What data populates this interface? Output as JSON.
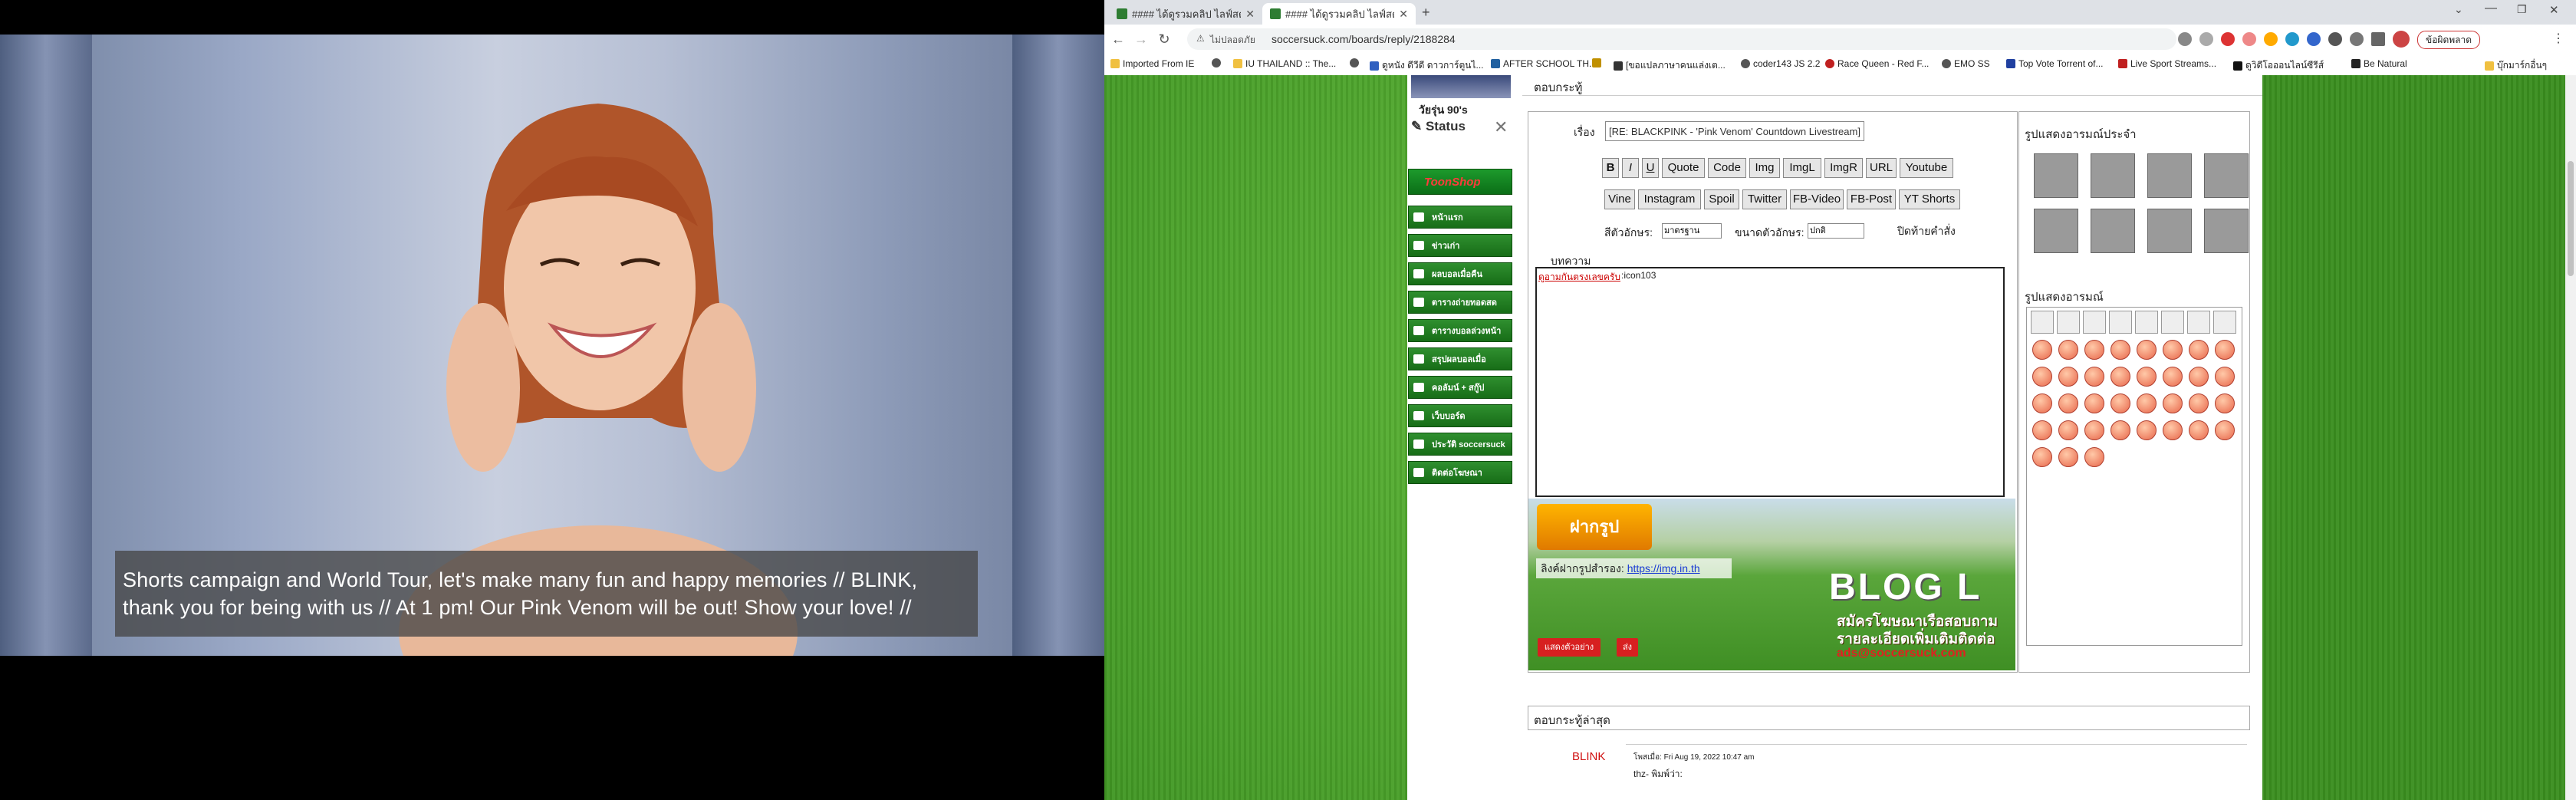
{
  "video": {
    "caption": "Shorts campaign and World Tour, let's make many fun and happy memories // BLINK, thank you for being with us // At 1 pm! Our Pink Venom will be out! Show your love! //"
  },
  "browser": {
    "tabs": [
      {
        "title": "#### ได้ดูรวมคลิป ไลฟ์สดว่าลูกของ...",
        "active": false
      },
      {
        "title": "#### ได้ดูรวมคลิป ไลฟ์สดว่าลูกของ...",
        "active": true
      }
    ],
    "new_tab": "+",
    "address": {
      "security": "ไม่ปลอดภัย",
      "url": "soccersuck.com/boards/reply/2188284"
    },
    "profile_button": "ข้อผิดพลาด",
    "bookmarks": [
      {
        "label": "Imported From IE",
        "color": "#f0c040"
      },
      {
        "label": "",
        "color": "#555"
      },
      {
        "label": "IU THAILAND :: The...",
        "color": "#f0c040"
      },
      {
        "label": "",
        "color": "#555"
      },
      {
        "label": "ดูหนัง ดีวีดี ดาวการ์ตูนไ...",
        "color": "#3060c0"
      },
      {
        "label": "AFTER SCHOOL TH...",
        "color": "#2060a0"
      },
      {
        "label": "",
        "color": "#c09000"
      },
      {
        "label": "[ขอแปลภาษาคนแล่งเต...",
        "color": "#333"
      },
      {
        "label": "coder143 JS 2.2",
        "color": "#555"
      },
      {
        "label": "Race Queen - Red F...",
        "color": "#c02020"
      },
      {
        "label": "EMO SS",
        "color": "#555"
      },
      {
        "label": "Top Vote Torrent of...",
        "color": "#2040a0"
      },
      {
        "label": "Live Sport Streams...",
        "color": "#c02020"
      },
      {
        "label": "ดูวิดีโอออนไลน์ซีรีส์",
        "color": "#111"
      },
      {
        "label": "Be Natural",
        "color": "#222"
      }
    ],
    "other_bookmarks": "บุ๊กมาร์กอื่นๆ"
  },
  "sidebar": {
    "generation": "วัยรุ่น 90's",
    "status": "Status",
    "shop": "ToonShop",
    "menu": [
      "หน้าแรก",
      "ข่าวเก่า",
      "ผลบอลเมื่อคืน",
      "ตารางถ่ายทอดสด",
      "ตารางบอลล่วงหน้า",
      "สรุปผลบอลเมื่อ",
      "คอลัมน์ + สกู๊ป",
      "เว็บบอร์ด",
      "ประวัติ soccersuck",
      "ติดต่อโฆษณา"
    ]
  },
  "form": {
    "header": "ตอบกระทู้",
    "subject_label": "เรื่อง",
    "subject_value": "[RE: BLACKPINK - 'Pink Venom' Countdown Livestream]",
    "format_buttons_row1": [
      "B",
      "I",
      "U",
      "Quote",
      "Code",
      "Img",
      "ImgL",
      "ImgR",
      "URL",
      "Youtube"
    ],
    "format_buttons_row2": [
      "Vine",
      "Instagram",
      "Spoil",
      "Twitter",
      "FB-Video",
      "FB-Post",
      "YT Shorts"
    ],
    "color_label": "สีตัวอักษร:",
    "color_value": "มาตรฐาน",
    "size_label": "ขนาดตัวอักษร:",
    "size_value": "ปกติ",
    "close_tags": "ปิดท้ายคำสั่ง",
    "body_label": "บทความ",
    "body_emoticon_text": "ดูอามกันตรงเลขครับ",
    "body_code": ":icon103",
    "upload_button": "ฝากรูป",
    "upload_link_label": "ลิงค์ฝากรูปสำรอง:",
    "upload_link": "https://img.in.th",
    "preview_button": "แสดงตัวอย่าง",
    "send_button": "ส่ง"
  },
  "promo": {
    "title": "BLOG L",
    "line1": "สมัครโฆษณาเรือสอบถาม",
    "line2": "รายละเอียดเพิ่มเติมติดต่อ",
    "line3": "ads@soccersuck.com"
  },
  "emoticons": {
    "personal_title": "รูปแสดงอารมณ์ประจำ",
    "avatar_count": 8,
    "panel_title": "รูปแสดงอารมณ์",
    "tab_count": 8,
    "emo_count": 35
  },
  "latest": {
    "title": "ตอบกระทู้ล่าสุด",
    "user": "BLINK",
    "date": "โพสเมื่อ: Fri Aug 19, 2022 10:47 am",
    "text": "thz- พิมพ์ว่า:"
  }
}
